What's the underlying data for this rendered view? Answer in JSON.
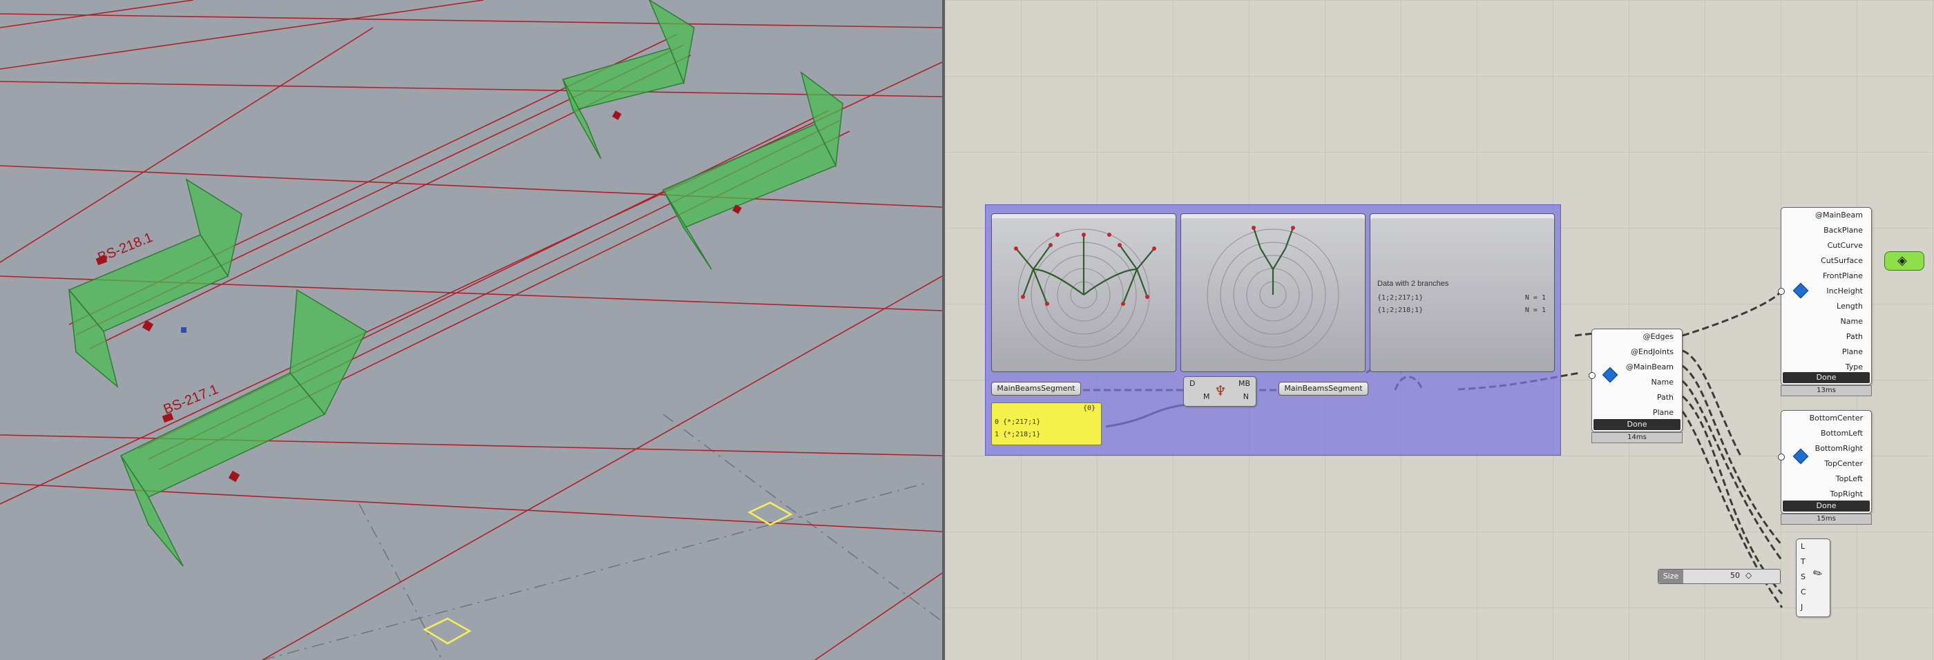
{
  "viewport": {
    "labels": [
      {
        "text": "BS-218.1"
      },
      {
        "text": "BS-217.1"
      }
    ]
  },
  "canvas": {
    "panels": {
      "data_panel": {
        "title": "Data with 2 branches",
        "rows": [
          {
            "path": "{1;2;217;1}",
            "count": "N = 1"
          },
          {
            "path": "{1;2;218;1}",
            "count": "N = 1"
          }
        ]
      }
    },
    "params": {
      "main_beams_segment_left": "MainBeamsSegment",
      "main_beams_segment_right": "MainBeamsSegment"
    },
    "yellow_panel": {
      "header": "{0}",
      "rows": [
        "0  {*;217;1}",
        "1  {*;218;1}"
      ]
    },
    "tree_comp": {
      "inputs": [
        "D",
        "M"
      ],
      "outputs": [
        "MB",
        "N"
      ]
    },
    "main_beam_comp": {
      "inputs": [
        "@Edges",
        "@EndJoints",
        "@MainBeam",
        "Name",
        "Path",
        "Plane"
      ],
      "status": "Done",
      "timer": "14ms"
    },
    "output_comp_top": {
      "outputs": [
        "@MainBeam",
        "BackPlane",
        "CutCurve",
        "CutSurface",
        "FrontPlane",
        "IncHeight",
        "Length",
        "Name",
        "Path",
        "Plane",
        "Type"
      ],
      "status": "Done",
      "timer": "13ms"
    },
    "output_comp_bottom": {
      "outputs": [
        "BottomCenter",
        "BottomLeft",
        "BottomRight",
        "TopCenter",
        "TopLeft",
        "TopRight"
      ],
      "status": "Done",
      "timer": "15ms"
    },
    "text_comp": {
      "inputs": [
        "L",
        "T",
        "S",
        "C",
        "J"
      ]
    },
    "size_slider": {
      "label": "Size",
      "value": "50"
    }
  }
}
